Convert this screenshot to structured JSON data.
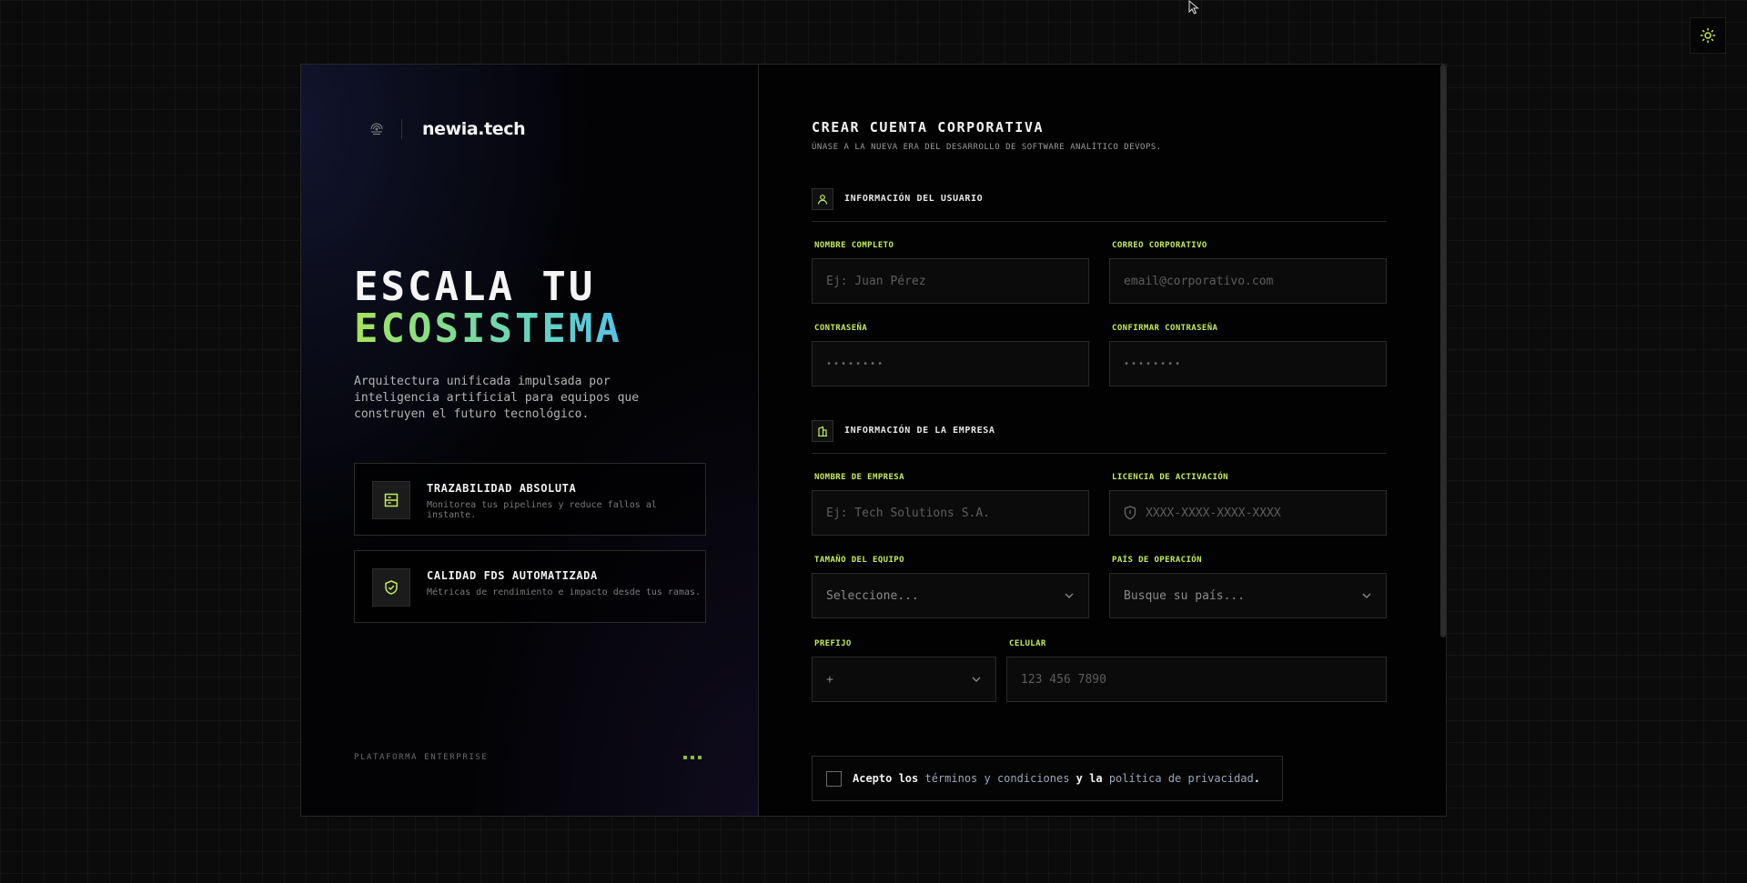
{
  "brand": {
    "name": "newia.tech",
    "logo_icon": "logo-icon"
  },
  "hero": {
    "line1": "ESCALA TU",
    "line2": "ECOSISTEMA",
    "description": "Arquitectura unificada impulsada por inteligencia artificial para equipos que construyen el futuro tecnológico."
  },
  "features": [
    {
      "title": "TRAZABILIDAD ABSOLUTA",
      "subtitle": "Monitorea tus pipelines y reduce fallos al instante.",
      "icon": "server-icon"
    },
    {
      "title": "CALIDAD FDS AUTOMATIZADA",
      "subtitle": "Métricas de rendimiento e impacto desde tus ramas.",
      "icon": "shield-check-icon"
    }
  ],
  "footer": {
    "label": "PLATAFORMA ENTERPRISE"
  },
  "form": {
    "title": "CREAR CUENTA CORPORATIVA",
    "subtitle": "ÚNASE A LA NUEVA ERA DEL DESARROLLO DE SOFTWARE ANALÍTICO DEVOPS.",
    "user_section": {
      "title": "INFORMACIÓN DEL USUARIO",
      "full_name": {
        "label": "NOMBRE COMPLETO",
        "placeholder": "Ej: Juan Pérez"
      },
      "email": {
        "label": "CORREO CORPORATIVO",
        "placeholder": "email@corporativo.com"
      },
      "password": {
        "label": "CONTRASEÑA",
        "placeholder": "••••••••"
      },
      "confirm_password": {
        "label": "CONFIRMAR CONTRASEÑA",
        "placeholder": "••••••••"
      }
    },
    "company_section": {
      "title": "INFORMACIÓN DE LA EMPRESA",
      "company_name": {
        "label": "NOMBRE DE EMPRESA",
        "placeholder": "Ej: Tech Solutions S.A."
      },
      "license": {
        "label": "LICENCIA DE ACTIVACIÓN",
        "placeholder": "XXXX-XXXX-XXXX-XXXX"
      },
      "team_size": {
        "label": "TAMAÑO DEL EQUIPO",
        "value": "Seleccione..."
      },
      "country": {
        "label": "PAÍS DE OPERACIÓN",
        "value": "Busque su país..."
      },
      "prefix": {
        "label": "PREFIJO",
        "value": "+"
      },
      "phone": {
        "label": "CELULAR",
        "placeholder": "123 456 7890"
      }
    },
    "terms": {
      "prefix": "Acepto los",
      "terms_link": "términos y condiciones",
      "middle": "y la",
      "privacy_link": "política de privacidad",
      "suffix": "."
    }
  },
  "theme_toggle_icon": "sun-icon",
  "colors": {
    "accent": "#c4ec5b",
    "background": "#0b0b0b",
    "card": "#020202",
    "border": "#2a2a2a"
  }
}
